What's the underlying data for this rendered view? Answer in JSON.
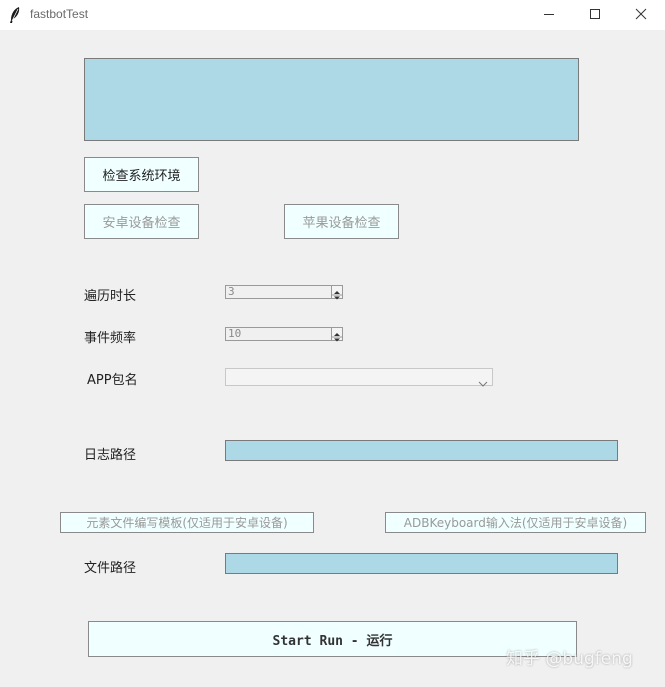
{
  "window": {
    "title": "fastbotTest",
    "controls": [
      "minimize-icon",
      "maximize-icon",
      "close-icon"
    ]
  },
  "buttons": {
    "check_env": "检查系统环境",
    "android_check": "安卓设备检查",
    "ios_check": "苹果设备检查",
    "element_template": "元素文件编写模板(仅适用于安卓设备)",
    "adb_keyboard": "ADBKeyboard输入法(仅适用于安卓设备)",
    "start_run": "Start Run - 运行"
  },
  "form": {
    "duration_label": "遍历时长",
    "duration_value": "3",
    "frequency_label": "事件频率",
    "frequency_value": "10",
    "package_label": "APP包名",
    "package_value": "",
    "log_path_label": "日志路径",
    "file_path_label": "文件路径"
  },
  "watermark": "知乎 @bugfeng",
  "colors": {
    "entry_bg": "#add8e6",
    "button_bg": "#f0ffff",
    "window_bg": "#f0f0f0"
  }
}
